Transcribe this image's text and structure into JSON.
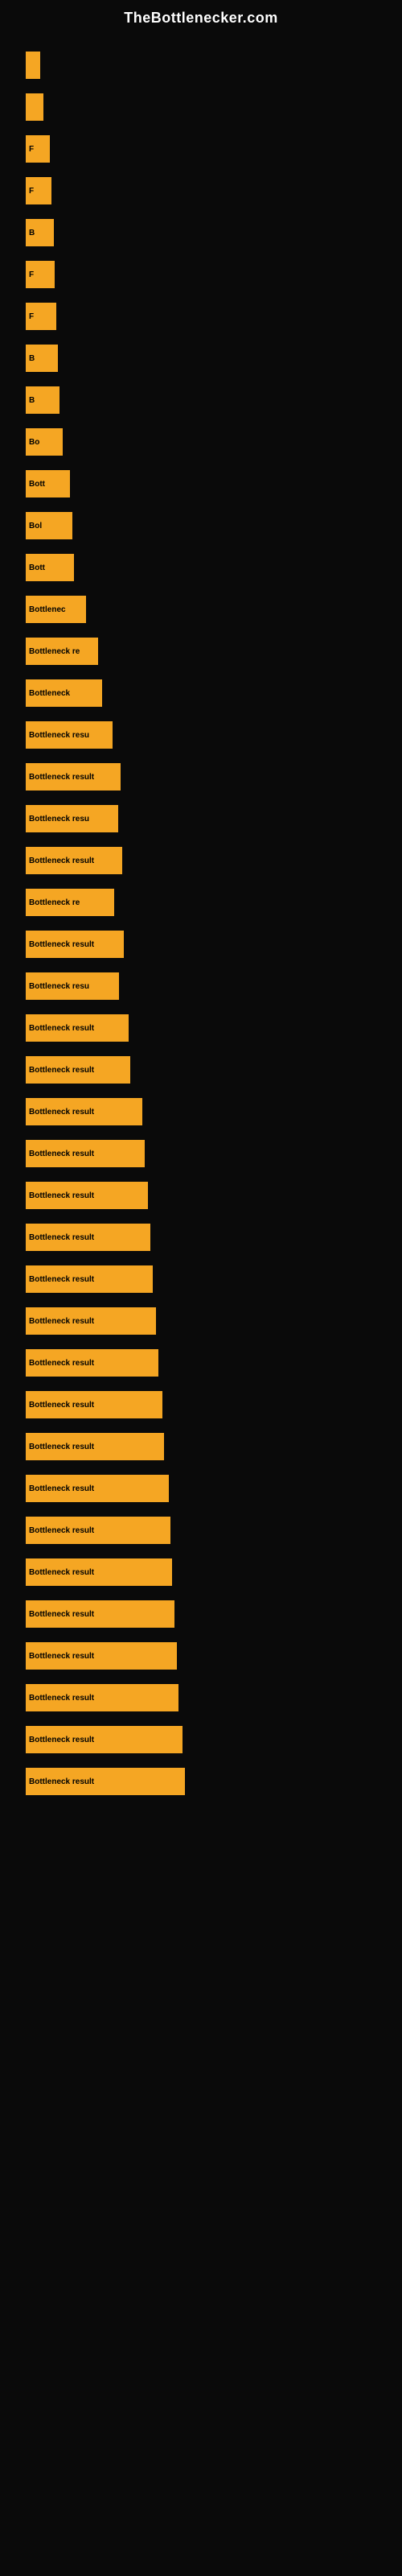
{
  "site": {
    "title": "TheBottlenecker.com"
  },
  "bars": [
    {
      "id": 1,
      "width": 18,
      "label": ""
    },
    {
      "id": 2,
      "width": 22,
      "label": ""
    },
    {
      "id": 3,
      "width": 30,
      "label": "F"
    },
    {
      "id": 4,
      "width": 32,
      "label": "F"
    },
    {
      "id": 5,
      "width": 35,
      "label": "B"
    },
    {
      "id": 6,
      "width": 36,
      "label": "F"
    },
    {
      "id": 7,
      "width": 38,
      "label": "F"
    },
    {
      "id": 8,
      "width": 40,
      "label": "B"
    },
    {
      "id": 9,
      "width": 42,
      "label": "B"
    },
    {
      "id": 10,
      "width": 46,
      "label": "Bo"
    },
    {
      "id": 11,
      "width": 55,
      "label": "Bott"
    },
    {
      "id": 12,
      "width": 58,
      "label": "Bol"
    },
    {
      "id": 13,
      "width": 60,
      "label": "Bott"
    },
    {
      "id": 14,
      "width": 75,
      "label": "Bottlenec"
    },
    {
      "id": 15,
      "width": 90,
      "label": "Bottleneck re"
    },
    {
      "id": 16,
      "width": 95,
      "label": "Bottleneck"
    },
    {
      "id": 17,
      "width": 108,
      "label": "Bottleneck resu"
    },
    {
      "id": 18,
      "width": 118,
      "label": "Bottleneck result"
    },
    {
      "id": 19,
      "width": 115,
      "label": "Bottleneck resu"
    },
    {
      "id": 20,
      "width": 120,
      "label": "Bottleneck result"
    },
    {
      "id": 21,
      "width": 110,
      "label": "Bottleneck re"
    },
    {
      "id": 22,
      "width": 122,
      "label": "Bottleneck result"
    },
    {
      "id": 23,
      "width": 116,
      "label": "Bottleneck resu"
    },
    {
      "id": 24,
      "width": 128,
      "label": "Bottleneck result"
    },
    {
      "id": 25,
      "width": 130,
      "label": "Bottleneck result"
    },
    {
      "id": 26,
      "width": 145,
      "label": "Bottleneck result"
    },
    {
      "id": 27,
      "width": 148,
      "label": "Bottleneck result"
    },
    {
      "id": 28,
      "width": 152,
      "label": "Bottleneck result"
    },
    {
      "id": 29,
      "width": 155,
      "label": "Bottleneck result"
    },
    {
      "id": 30,
      "width": 158,
      "label": "Bottleneck result"
    },
    {
      "id": 31,
      "width": 162,
      "label": "Bottleneck result"
    },
    {
      "id": 32,
      "width": 165,
      "label": "Bottleneck result"
    },
    {
      "id": 33,
      "width": 170,
      "label": "Bottleneck result"
    },
    {
      "id": 34,
      "width": 172,
      "label": "Bottleneck result"
    },
    {
      "id": 35,
      "width": 178,
      "label": "Bottleneck result"
    },
    {
      "id": 36,
      "width": 180,
      "label": "Bottleneck result"
    },
    {
      "id": 37,
      "width": 182,
      "label": "Bottleneck result"
    },
    {
      "id": 38,
      "width": 185,
      "label": "Bottleneck result"
    },
    {
      "id": 39,
      "width": 188,
      "label": "Bottleneck result"
    },
    {
      "id": 40,
      "width": 190,
      "label": "Bottleneck result"
    },
    {
      "id": 41,
      "width": 195,
      "label": "Bottleneck result"
    },
    {
      "id": 42,
      "width": 198,
      "label": "Bottleneck result"
    }
  ]
}
